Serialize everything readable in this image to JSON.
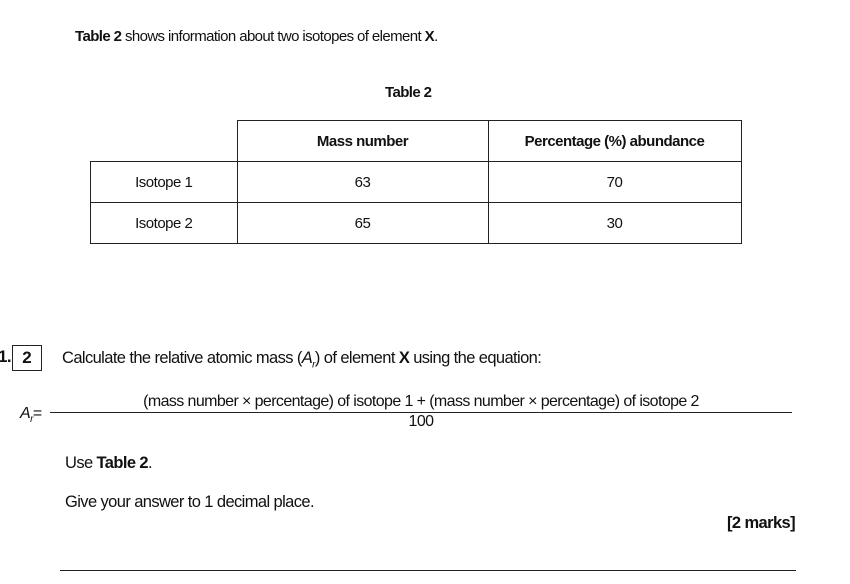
{
  "intro": {
    "bold1": "Table 2",
    "text1": " shows information about two isotopes of element ",
    "bold2": "X",
    "text2": "."
  },
  "table": {
    "caption": "Table 2",
    "headers": [
      "",
      "Mass number",
      "Percentage (%) abundance"
    ],
    "rows": [
      [
        "Isotope 1",
        "63",
        "70"
      ],
      [
        "Isotope 2",
        "65",
        "30"
      ]
    ]
  },
  "question": {
    "prefix": "1.",
    "number": "2",
    "text_a": "Calculate the relative atomic mass (",
    "ar_symbol": "A",
    "ar_sub": "r",
    "text_b": ") of element ",
    "bold_x": "X",
    "text_c": " using the equation:",
    "equation": {
      "lhs": "A",
      "lhs_sub": "r",
      "equals": "=",
      "numerator": "(mass number × percentage) of isotope 1 + (mass number × percentage) of isotope 2",
      "denominator": "100"
    },
    "use_a": "Use ",
    "use_bold": "Table 2",
    "use_b": ".",
    "instruction": "Give your answer to 1 decimal place.",
    "marks": "[2 marks]"
  }
}
